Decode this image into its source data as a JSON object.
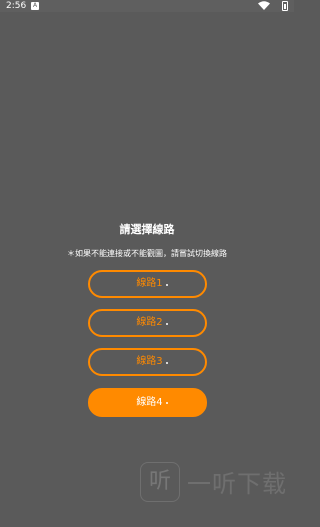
{
  "status_bar": {
    "time": "2:56",
    "notification_icon": "A"
  },
  "dialog": {
    "title": "請選擇線路",
    "hint": "＊如果不能連接或不能觀圖，請嘗試切換線路"
  },
  "routes": [
    {
      "label": "線路1",
      "active": false
    },
    {
      "label": "線路2",
      "active": false
    },
    {
      "label": "線路3",
      "active": false
    },
    {
      "label": "線路4",
      "active": true
    }
  ],
  "watermark": {
    "logo_char": "听",
    "text": "一听下载"
  },
  "colors": {
    "accent": "#ff8a00",
    "background": "#5a5a5a"
  }
}
